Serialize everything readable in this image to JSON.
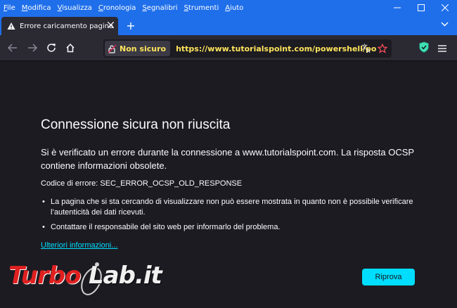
{
  "menu": {
    "items": [
      "File",
      "Modifica",
      "Visualizza",
      "Cronologia",
      "Segnalibri",
      "Strumenti",
      "Aiuto"
    ]
  },
  "tab": {
    "title": "Errore caricamento pagina",
    "new_tab_label": "+"
  },
  "urlbar": {
    "security_label": "Non sicuro",
    "url": "https://www.tutorialspoint.com/powershell/powershell_c"
  },
  "error": {
    "title": "Connessione sicura non riuscita",
    "description": "Si è verificato un errore durante la connessione a www.tutorialspoint.com. La risposta OCSP contiene informazioni obsolete.",
    "code": "Codice di errore: SEC_ERROR_OCSP_OLD_RESPONSE",
    "bullets": [
      "La pagina che si sta cercando di visualizzare non può essere mostrata in quanto non è possibile verificare l’autenticità dei dati ricevuti.",
      "Contattare il responsabile del sito web per informarlo del problema."
    ],
    "more_link": "Ulteriori informazioni...",
    "retry_button": "Riprova"
  },
  "watermark": {
    "part1": "Turbo",
    "part2": "Lab.it"
  },
  "colors": {
    "titlebar": "#1f6feb",
    "toolbar": "#2b2a33",
    "content_bg": "#1c1b22",
    "warning_text": "#ffe55c",
    "accent": "#00ddff"
  }
}
